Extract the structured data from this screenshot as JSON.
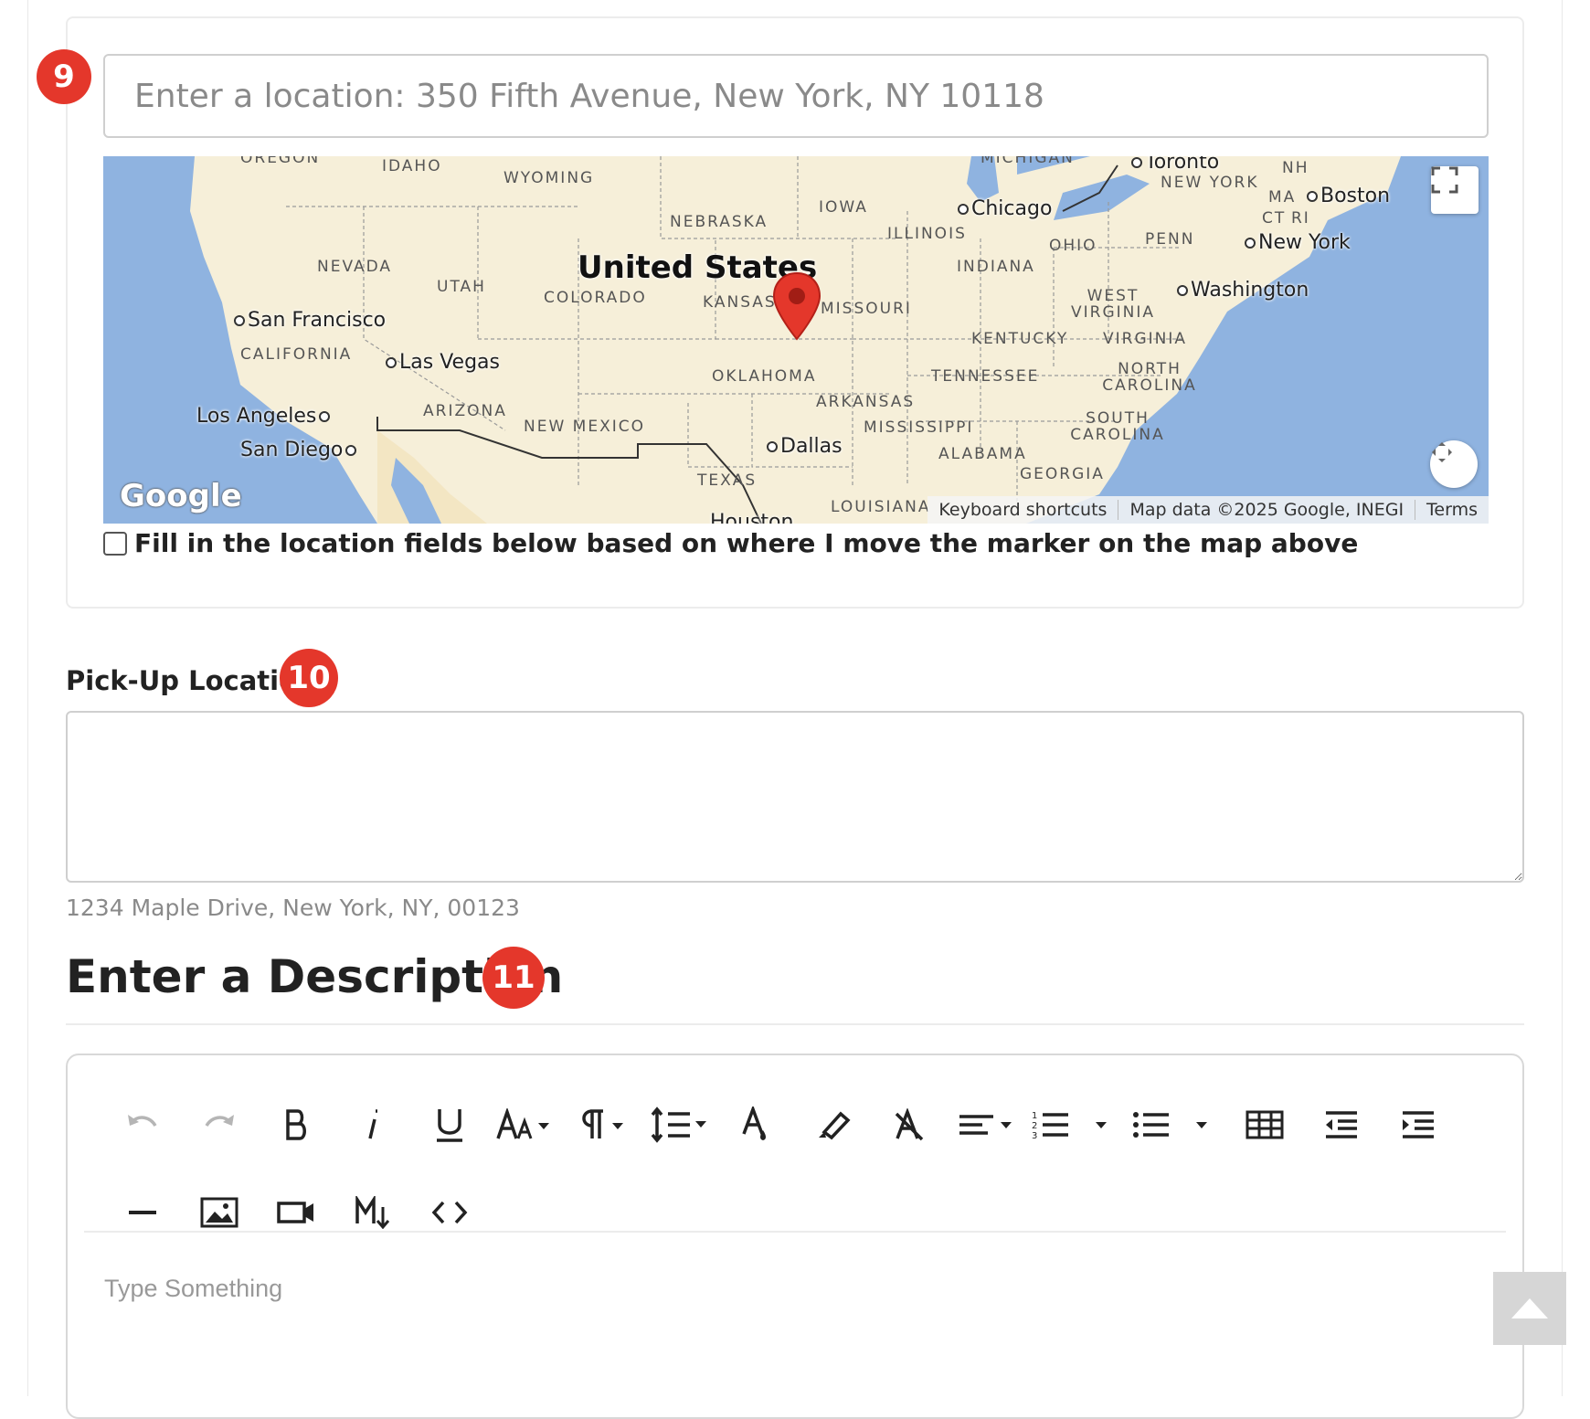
{
  "location_search": {
    "badge": "9",
    "placeholder": "Enter a location: 350 Fifth Avenue, New York, NY 10118"
  },
  "map": {
    "country_label": "United States",
    "state_labels": [
      "OREGON",
      "IDAHO",
      "WYOMING",
      "NEBRASKA",
      "IOWA",
      "NEVADA",
      "UTAH",
      "COLORADO",
      "KANSAS",
      "MISSOURI",
      "ILLINOIS",
      "INDIANA",
      "OHIO",
      "PENN",
      "NEW YORK",
      "NH",
      "MA",
      "CT",
      "RI",
      "CALIFORNIA",
      "ARIZONA",
      "NEW MEXICO",
      "OKLAHOMA",
      "ARKANSAS",
      "TENNESSEE",
      "KENTUCKY",
      "WEST VIRGINIA",
      "VIRGINIA",
      "NORTH CAROLINA",
      "SOUTH CAROLINA",
      "MISSISSIPPI",
      "ALABAMA",
      "GEORGIA",
      "TEXAS",
      "LOUISIANA",
      "MICHIGAN"
    ],
    "city_labels": [
      "San Francisco",
      "Las Vegas",
      "Los Angeles",
      "San Diego",
      "Dallas",
      "Chicago",
      "Toronto",
      "Boston",
      "New York",
      "Washington",
      "Houston"
    ],
    "logo_text": "Google",
    "attribution": {
      "keyboard_shortcuts": "Keyboard shortcuts",
      "map_data": "Map data ©2025 Google, INEGI",
      "terms": "Terms"
    },
    "colors": {
      "water": "#8fb3e0",
      "land": "#f6efd9",
      "marker": "#e4372b"
    }
  },
  "fill_from_marker": {
    "label": "Fill in the location fields below based on where I move the marker on the map above",
    "checked": false
  },
  "pickup": {
    "label": "Pick-Up Location",
    "badge": "10",
    "value": "",
    "helper": "1234 Maple Drive, New York, NY, 00123"
  },
  "description": {
    "title": "Enter a Description",
    "badge": "11",
    "placeholder": "Type Something",
    "toolbar_icons": [
      "undo-icon",
      "redo-icon",
      "bold-icon",
      "italic-icon",
      "underline-icon",
      "font-size-icon",
      "paragraph-icon",
      "line-height-icon",
      "text-color-icon",
      "highlight-icon",
      "clear-format-icon",
      "align-icon",
      "ordered-list-icon",
      "unordered-list-icon",
      "table-icon",
      "outdent-icon",
      "indent-icon",
      "horizontal-rule-icon",
      "image-icon",
      "video-icon",
      "markdown-icon",
      "code-view-icon"
    ]
  },
  "colors": {
    "badge": "#e4372b",
    "border": "#cfcfcf"
  }
}
